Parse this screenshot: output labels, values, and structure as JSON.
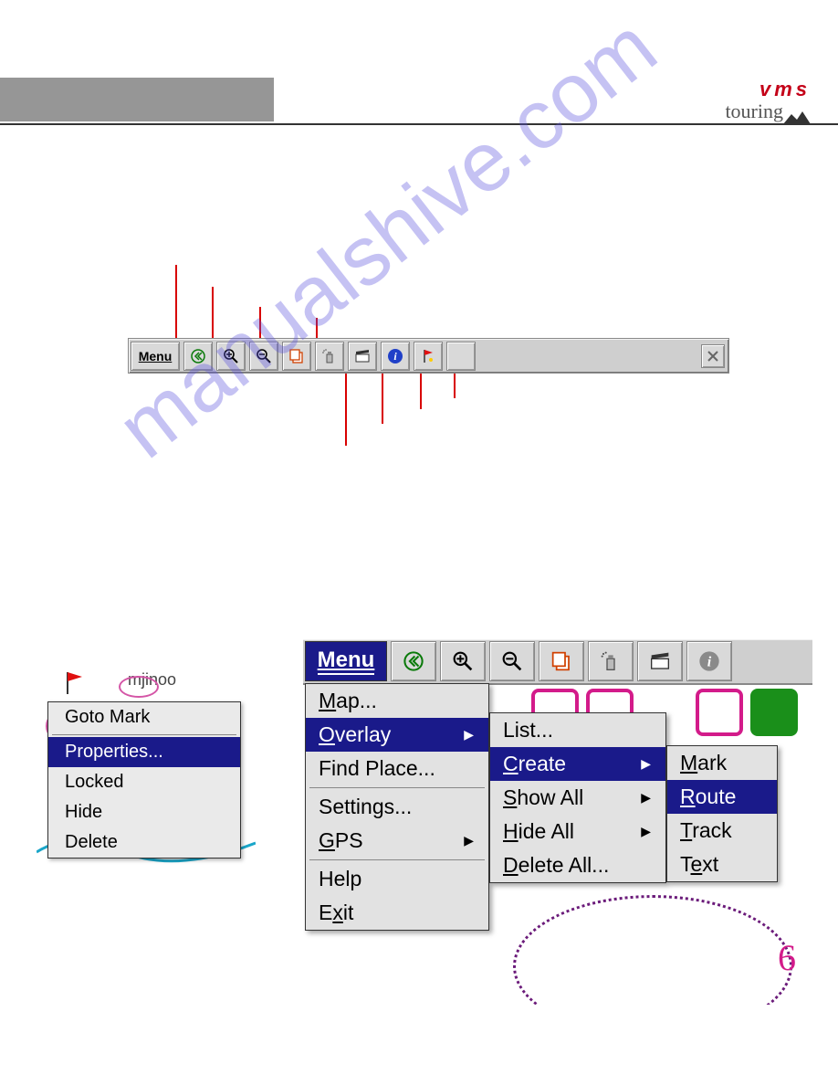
{
  "logo": {
    "top": "vms",
    "bottom": "touring"
  },
  "toolbar": {
    "menu_label": "Menu"
  },
  "watermark": "manualshive.com",
  "context_menu": {
    "title_text": "mjinoo",
    "items": {
      "i0": "Goto Mark",
      "i1": "Properties...",
      "i2": "Locked",
      "i3": "Hide",
      "i4": "Delete"
    }
  },
  "big_menu": {
    "toolbar": {
      "menu_label": "Menu"
    },
    "col1": {
      "map": "Map...",
      "overlay": "Overlay",
      "find": "Find Place...",
      "settings": "Settings...",
      "gps": "GPS",
      "help": "Help",
      "exit": "Exit"
    },
    "col2": {
      "list": "List...",
      "create": "Create",
      "showall": "Show All",
      "hideall": "Hide All",
      "deleteall": "Delete All..."
    },
    "col3": {
      "mark": "Mark",
      "route": "Route",
      "track": "Track",
      "text": "Text"
    },
    "map_num": "6"
  }
}
